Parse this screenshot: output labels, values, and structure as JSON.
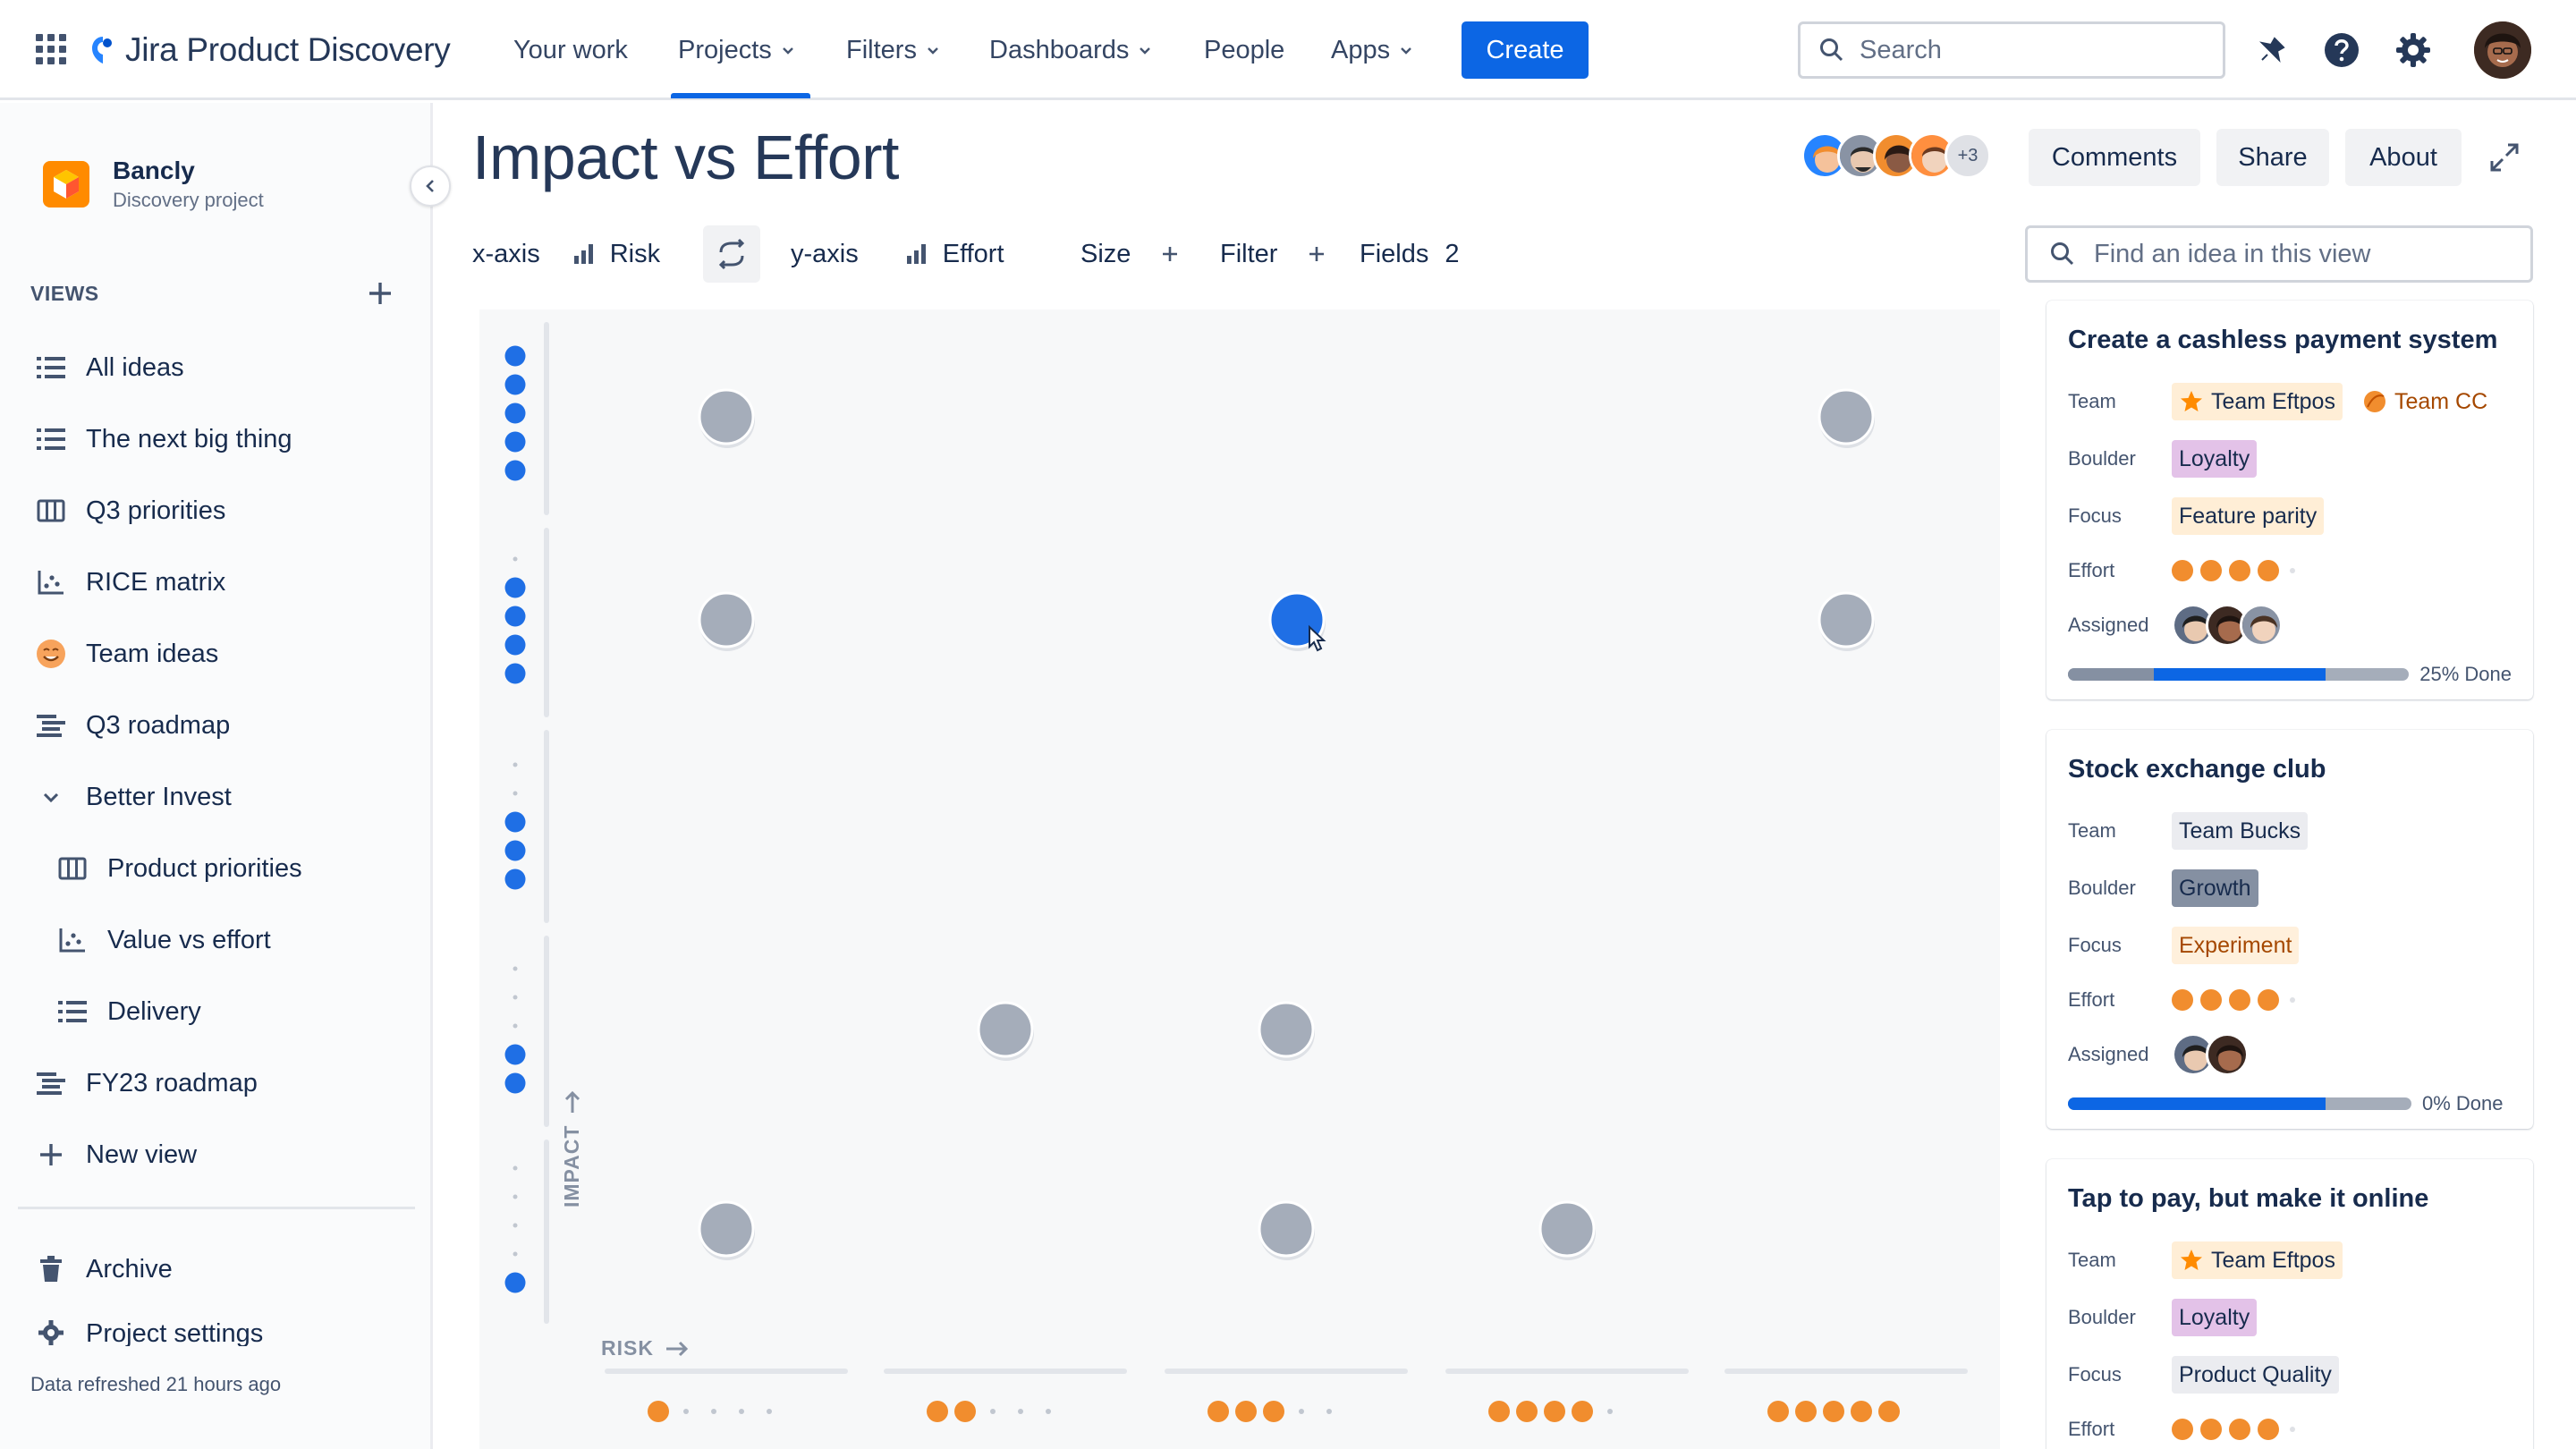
{
  "nav": {
    "logo": "Jira Product Discovery",
    "items": [
      {
        "label": "Your work",
        "has_menu": false
      },
      {
        "label": "Projects",
        "has_menu": true,
        "active": true
      },
      {
        "label": "Filters",
        "has_menu": true
      },
      {
        "label": "Dashboards",
        "has_menu": true
      },
      {
        "label": "People",
        "has_menu": false
      },
      {
        "label": "Apps",
        "has_menu": true
      }
    ],
    "create": "Create",
    "search_placeholder": "Search",
    "icons": [
      "notifications-icon",
      "help-icon",
      "settings-icon"
    ],
    "accent": "#0c66e4"
  },
  "sidebar": {
    "project_name": "Bancly",
    "project_type": "Discovery project",
    "views_heading": "VIEWS",
    "items": [
      {
        "label": "All ideas",
        "icon": "list-icon"
      },
      {
        "label": "The next big thing",
        "icon": "list-icon"
      },
      {
        "label": "Q3 priorities",
        "icon": "board-icon"
      },
      {
        "label": "RICE matrix",
        "icon": "matrix-icon"
      },
      {
        "label": "Team ideas",
        "icon": "emoji-icon"
      },
      {
        "label": "Q3 roadmap",
        "icon": "timeline-icon"
      },
      {
        "label": "Better Invest",
        "icon": "chevron-down-icon"
      },
      {
        "label": "Product priorities",
        "icon": "board-icon"
      },
      {
        "label": "Value vs effort",
        "icon": "matrix-icon"
      },
      {
        "label": "Delivery",
        "icon": "list-icon"
      },
      {
        "label": "FY23 roadmap",
        "icon": "timeline-icon"
      },
      {
        "label": "New view",
        "icon": "plus-icon"
      }
    ],
    "archive": "Archive",
    "project_settings": "Project settings",
    "refreshed": "Data refreshed 21 hours ago"
  },
  "header": {
    "title": "Impact vs Effort",
    "avatars_more": "+3",
    "buttons": [
      "Comments",
      "Share",
      "About"
    ]
  },
  "toolbar": {
    "x_axis": "x-axis",
    "x_field": "Risk",
    "y_axis": "y-axis",
    "y_field": "Effort",
    "size": "Size",
    "filter": "Filter",
    "fields": "Fields",
    "fields_count": "2",
    "find_placeholder": "Find an idea in this view"
  },
  "chart_data": {
    "type": "scatter",
    "xlabel": "RISK",
    "ylabel": "IMPACT",
    "x_levels": [
      1,
      2,
      3,
      4,
      5
    ],
    "y_levels": [
      1,
      2,
      3,
      4,
      5
    ],
    "points": [
      {
        "x": 1,
        "y": 5,
        "selected": false
      },
      {
        "x": 5,
        "y": 5,
        "selected": false
      },
      {
        "x": 1,
        "y": 4,
        "selected": false
      },
      {
        "x": 3,
        "y": 4,
        "selected": true
      },
      {
        "x": 5,
        "y": 4,
        "selected": false
      },
      {
        "x": 2,
        "y": 2,
        "selected": false
      },
      {
        "x": 3,
        "y": 2,
        "selected": false
      },
      {
        "x": 1,
        "y": 1,
        "selected": false
      },
      {
        "x": 3,
        "y": 1,
        "selected": false
      },
      {
        "x": 4,
        "y": 1,
        "selected": false
      }
    ],
    "point_color": "#a5adba",
    "selected_color": "#1f6fe5",
    "axis_dot_color": "#1f6fe5",
    "x_dot_color": "#f18d2e"
  },
  "cards": [
    {
      "title": "Create a cashless payment system",
      "team_label": "Team",
      "teams": [
        {
          "label": "Team Eftpos",
          "icon": "star-icon",
          "bg": "#ffeed6",
          "color": "#172b4d"
        },
        {
          "label": "Team CC",
          "icon": "leaf-icon",
          "bg": "#ffffff",
          "color": "#a54800"
        }
      ],
      "boulder_label": "Boulder",
      "boulder": {
        "label": "Loyalty",
        "bg": "#e3c2e8",
        "color": "#172b4d"
      },
      "focus_label": "Focus",
      "focus": {
        "label": "Feature parity",
        "bg": "#ffeed6",
        "color": "#172b4d"
      },
      "effort_label": "Effort",
      "effort": 4,
      "assigned_label": "Assigned",
      "assigned_count": 3,
      "progress_done": 0.25,
      "progress_inprogress": 0.5,
      "progress_text": "25% Done"
    },
    {
      "title": "Stock exchange club",
      "team_label": "Team",
      "teams": [
        {
          "label": "Team Bucks",
          "icon": "",
          "bg": "#ebecf0",
          "color": "#172b4d"
        }
      ],
      "boulder_label": "Boulder",
      "boulder": {
        "label": "Growth",
        "bg": "#8590a2",
        "color": "#172b4d"
      },
      "focus_label": "Focus",
      "focus": {
        "label": "Experiment",
        "bg": "#fff0dc",
        "color": "#a54800"
      },
      "effort_label": "Effort",
      "effort": 4,
      "assigned_label": "Assigned",
      "assigned_count": 2,
      "progress_done": 0,
      "progress_inprogress": 0.75,
      "progress_text": "0% Done"
    },
    {
      "title": "Tap to pay, but make it online",
      "team_label": "Team",
      "teams": [
        {
          "label": "Team Eftpos",
          "icon": "star-icon",
          "bg": "#ffeed6",
          "color": "#172b4d"
        }
      ],
      "boulder_label": "Boulder",
      "boulder": {
        "label": "Loyalty",
        "bg": "#e3c2e8",
        "color": "#172b4d"
      },
      "focus_label": "Focus",
      "focus": {
        "label": "Product Quality",
        "bg": "#ebecf0",
        "color": "#172b4d"
      },
      "effort_label": "Effort",
      "effort": 4
    }
  ]
}
